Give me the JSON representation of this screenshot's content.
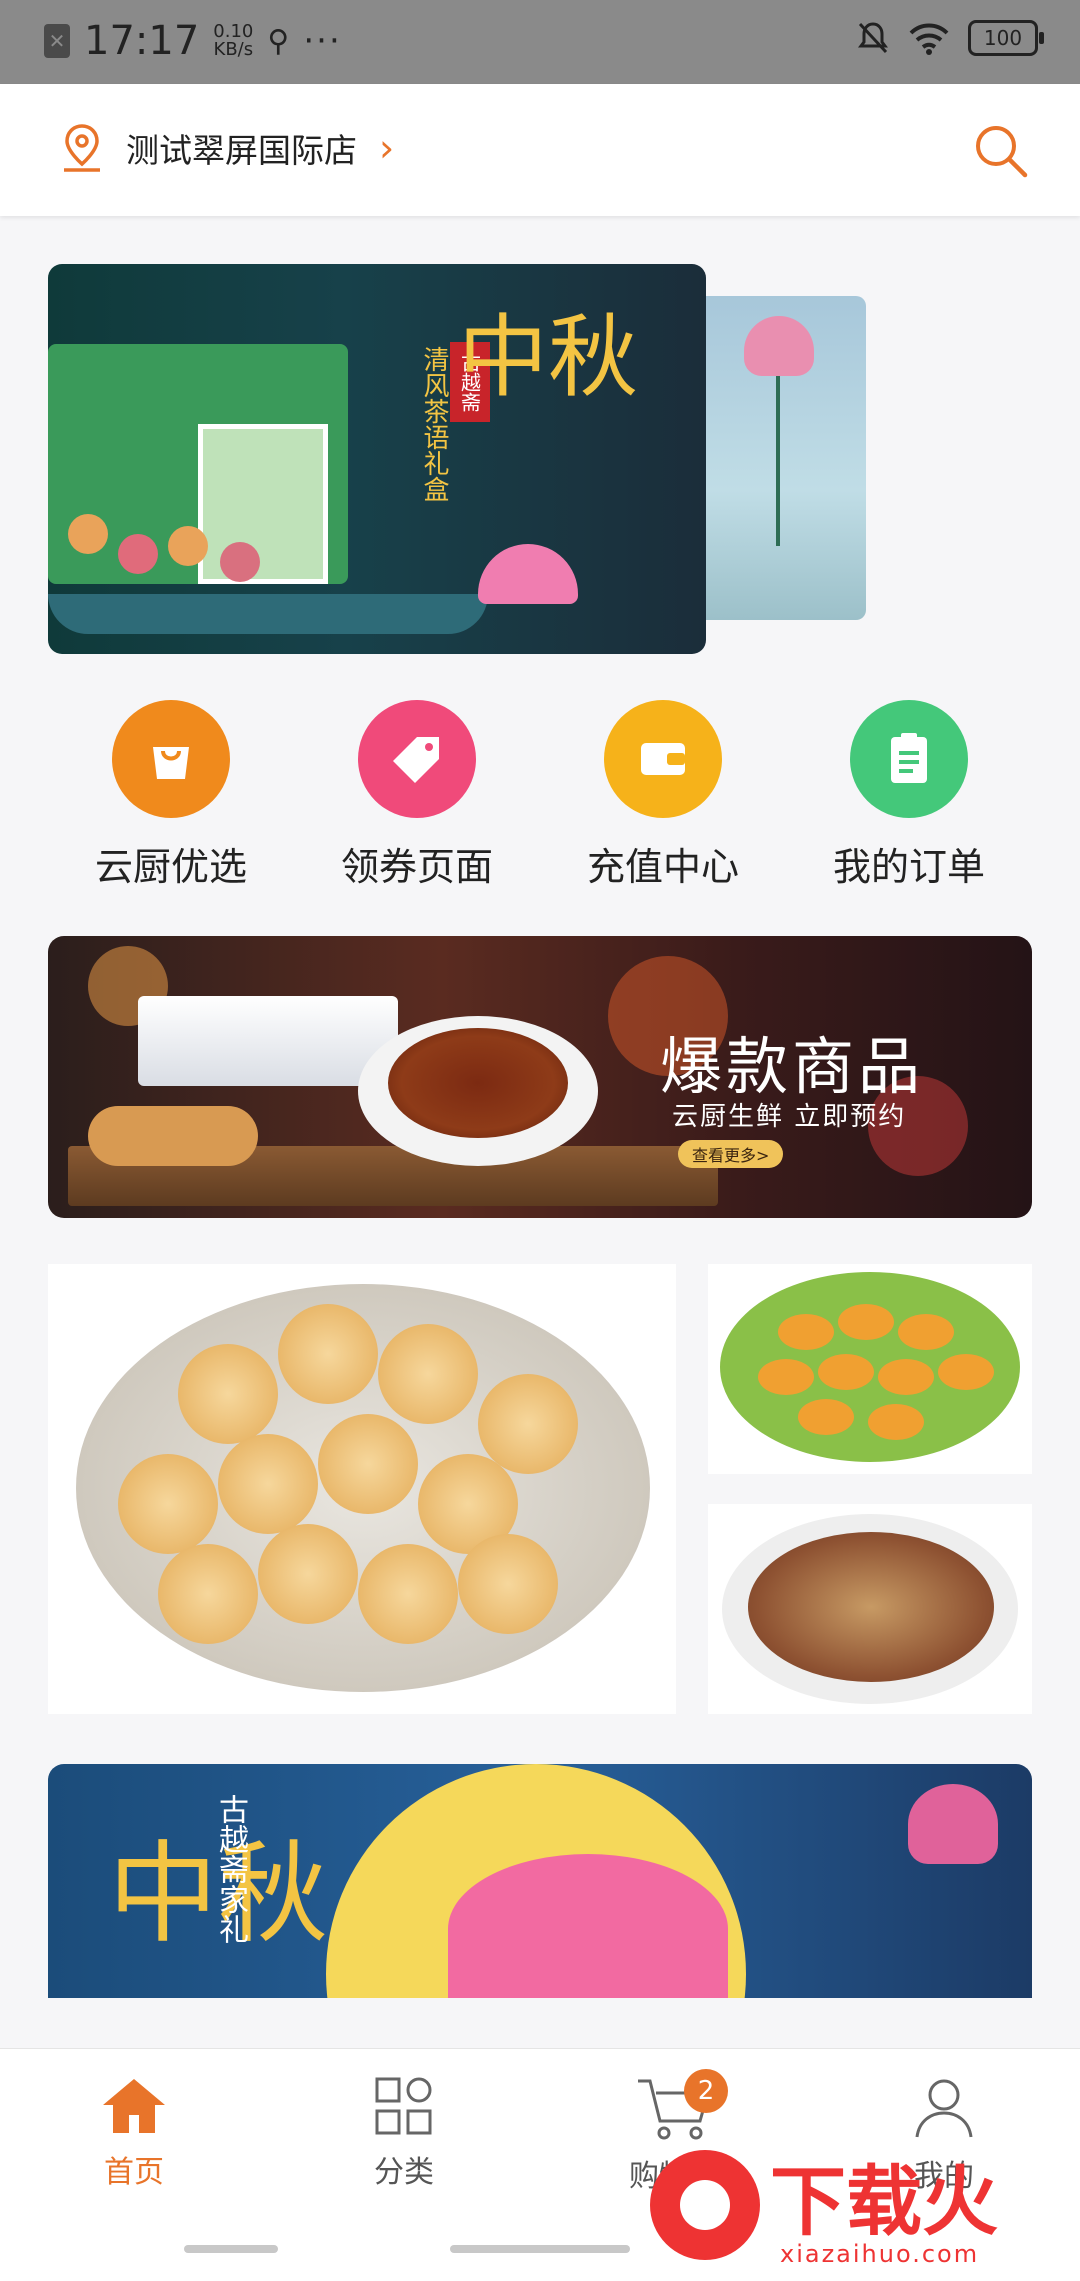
{
  "status_bar": {
    "time": "17:17",
    "net_speed_value": "0.10",
    "net_speed_unit": "KB/s",
    "more": "···",
    "battery": "100"
  },
  "header": {
    "store_name": "测试翠屏国际店",
    "accent": "#e8742a"
  },
  "categories": [
    {
      "label": "云厨优选",
      "icon": "shopping-bag-icon",
      "color": "#f08a1c"
    },
    {
      "label": "领券页面",
      "icon": "tag-icon",
      "color": "#f04a7a"
    },
    {
      "label": "充值中心",
      "icon": "wallet-icon",
      "color": "#f6b21a"
    },
    {
      "label": "我的订单",
      "icon": "clipboard-icon",
      "color": "#44c87a"
    }
  ],
  "carousel": {
    "title": "中秋",
    "tag": "古越斋",
    "subtitle": "清风茶语礼盒"
  },
  "promo_banner": {
    "title": "爆款商品",
    "subtitle": "云厨生鲜 立即预约",
    "button": "查看更多>"
  },
  "banner2": {
    "title": "中秋",
    "subtitle": "古越斋家礼"
  },
  "tabbar": {
    "tabs": [
      {
        "label": "首页",
        "icon": "home-icon",
        "active": true
      },
      {
        "label": "分类",
        "icon": "grid-icon",
        "active": false
      },
      {
        "label": "购物车",
        "icon": "cart-icon",
        "active": false,
        "badge": "2"
      },
      {
        "label": "我的",
        "icon": "user-icon",
        "active": false
      }
    ]
  },
  "watermark": {
    "text": "下载火",
    "url": "xiazaihuo.com"
  }
}
